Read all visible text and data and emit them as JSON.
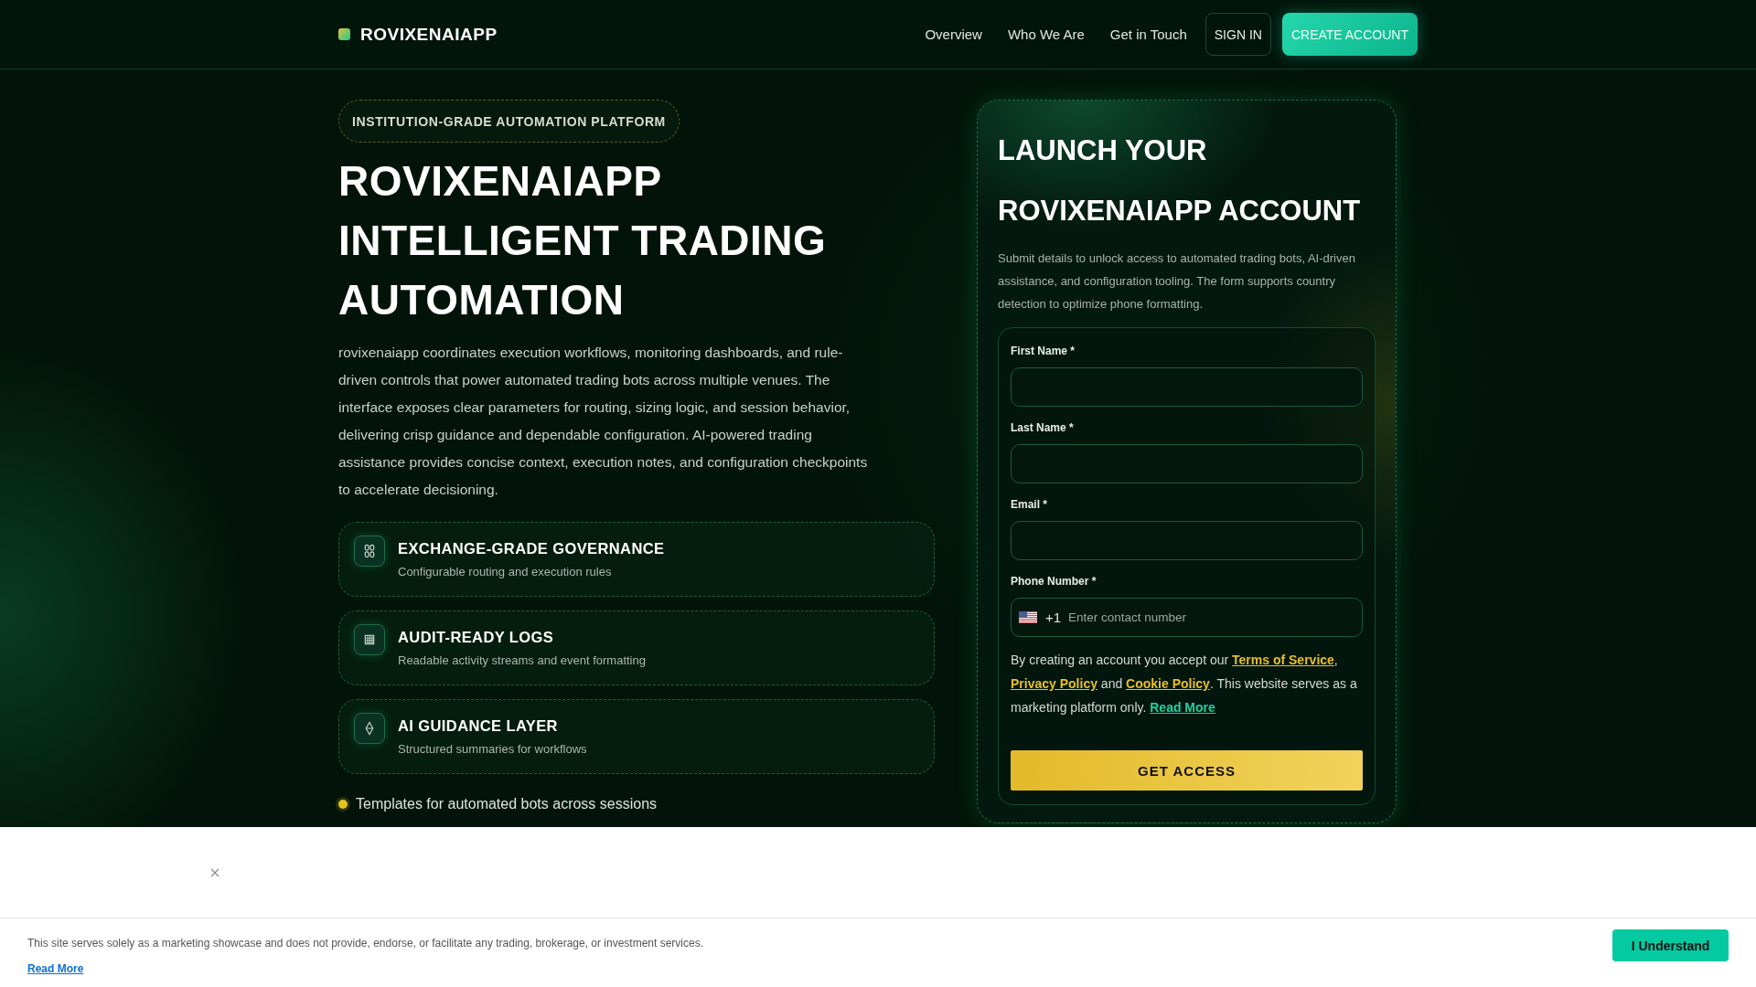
{
  "header": {
    "logo": "ROVIXENAIAPP",
    "nav": [
      "Overview",
      "Who We Are",
      "Get in Touch"
    ],
    "buttons": [
      {
        "label": "SIGN IN",
        "kind": "outline"
      },
      {
        "label": "CREATE ACCOUNT",
        "kind": "primary"
      }
    ]
  },
  "hero": {
    "badge": "INSTITUTION-GRADE AUTOMATION PLATFORM",
    "title": "ROVIXENAIAPP INTELLIGENT TRADING AUTOMATION",
    "description": "rovixenaiapp coordinates execution workflows, monitoring dashboards, and rule-driven controls that power automated trading bots across multiple venues. The interface exposes clear parameters for routing, sizing logic, and session behavior, delivering crisp guidance and dependable configuration. AI-powered trading assistance provides concise context, execution notes, and configuration checkpoints to accelerate decisioning.",
    "features": [
      {
        "title": "EXCHANGE-GRADE GOVERNANCE",
        "subtitle": "Configurable routing and execution rules"
      },
      {
        "title": "AUDIT-READY LOGS",
        "subtitle": "Readable activity streams and event formatting"
      },
      {
        "title": "AI GUIDANCE LAYER",
        "subtitle": "Structured summaries for workflows"
      }
    ],
    "bullet": "Templates for automated bots across sessions"
  },
  "signup": {
    "title": "LAUNCH YOUR ROVIXENAIAPP ACCOUNT",
    "description": "Submit details to unlock access to automated trading bots, AI-driven assistance, and configuration tooling. The form supports country detection to optimize phone formatting.",
    "fields": [
      {
        "label": "First Name *",
        "kind": "text"
      },
      {
        "label": "Last Name *",
        "kind": "text"
      },
      {
        "label": "Email *",
        "kind": "text"
      },
      {
        "label": "Phone Number *",
        "kind": "phone",
        "country_code": "+1",
        "placeholder": "Enter contact number"
      }
    ],
    "consent": [
      {
        "kind": "text",
        "text": "By creating an account you accept our "
      },
      {
        "kind": "link",
        "text": "Terms of Service"
      },
      {
        "kind": "text",
        "text": ", "
      },
      {
        "kind": "link",
        "text": "Privacy Policy"
      },
      {
        "kind": "text",
        "text": " and "
      },
      {
        "kind": "link",
        "text": "Cookie Policy"
      },
      {
        "kind": "text",
        "text": ". This website serves as a marketing platform only. "
      },
      {
        "kind": "more_link",
        "text": "Read More"
      }
    ],
    "submit": "GET ACCESS"
  },
  "cookie_notice": {
    "text": "This site serves solely as a marketing showcase and does not provide, endorse, or facilitate any trading, brokerage, or investment services.",
    "link": "Read More",
    "button": "I Understand"
  }
}
